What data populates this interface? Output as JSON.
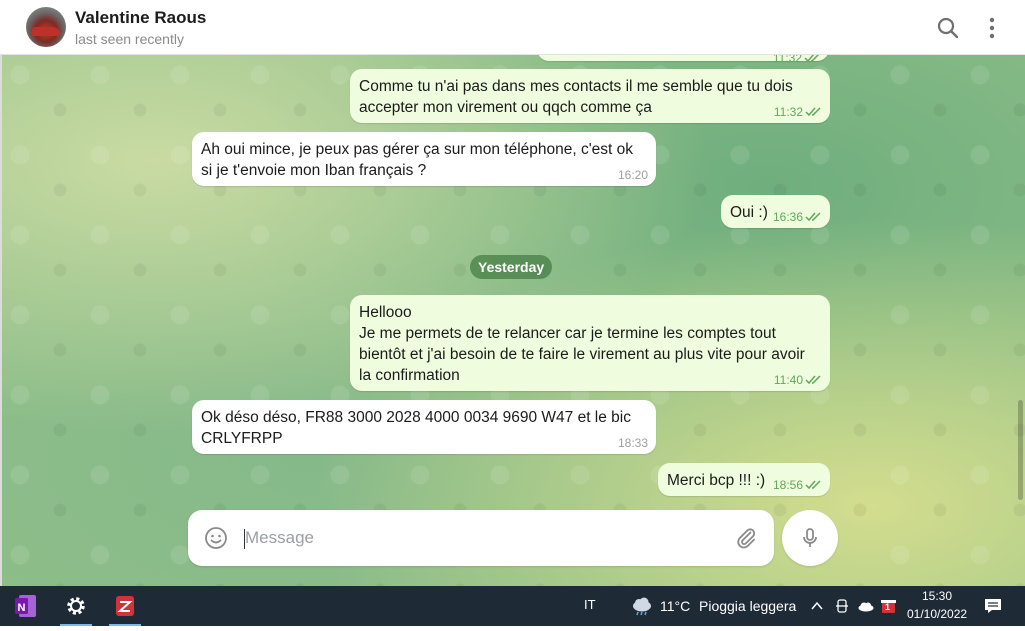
{
  "header": {
    "name": "Valentine Raous",
    "status": "last seen recently"
  },
  "messages": [
    {
      "type": "out",
      "text": "",
      "time": "11:32"
    },
    {
      "type": "out",
      "text": "Comme tu n'ai pas dans mes contacts il me semble que tu dois\naccepter mon virement ou qqch comme ça",
      "time": "11:32"
    },
    {
      "type": "in",
      "text": "Ah oui mince, je peux pas gérer ça sur mon téléphone, c'est ok\nsi je t'envoie mon Iban français ?",
      "time": "16:20"
    },
    {
      "type": "out",
      "text": "Oui :)",
      "time": "16:36"
    },
    {
      "type": "out",
      "text": "Hellooo\nJe me permets de te relancer car je termine les comptes tout\nbientôt et j'ai besoin de te faire le virement au plus vite pour avoir\nla confirmation",
      "time": "11:40"
    },
    {
      "type": "in",
      "text": "Ok déso déso, FR88 3000 2028 4000 0034 9690 W47 et le bic\nCRLYFRPP",
      "time": "18:33"
    },
    {
      "type": "out",
      "text": "Merci bcp !!! :)",
      "time": "18:56"
    }
  ],
  "date_separator": "Yesterday",
  "composer": {
    "placeholder": "Message"
  },
  "taskbar": {
    "language": "IT",
    "weather_temp": "11°C",
    "weather_desc": "Pioggia leggera",
    "time": "15:30",
    "date": "01/10/2022",
    "notification_badge": "1"
  },
  "icons": {
    "header": [
      "search-icon",
      "more-vertical-icon"
    ],
    "composer": [
      "emoji-icon",
      "attachment-icon",
      "microphone-icon"
    ],
    "taskbar_apps": [
      "onenote-icon",
      "settings-icon",
      "red-app-icon"
    ],
    "tray": [
      "weather-cloud-icon",
      "chevron-up-icon",
      "device-icon",
      "onedrive-icon",
      "notification-app-icon",
      "action-center-icon"
    ]
  },
  "colors": {
    "outgoing_bubble": "#effdde",
    "incoming_bubble": "#ffffff",
    "check_marks": "#5fa959",
    "taskbar": "#1f2a37"
  }
}
